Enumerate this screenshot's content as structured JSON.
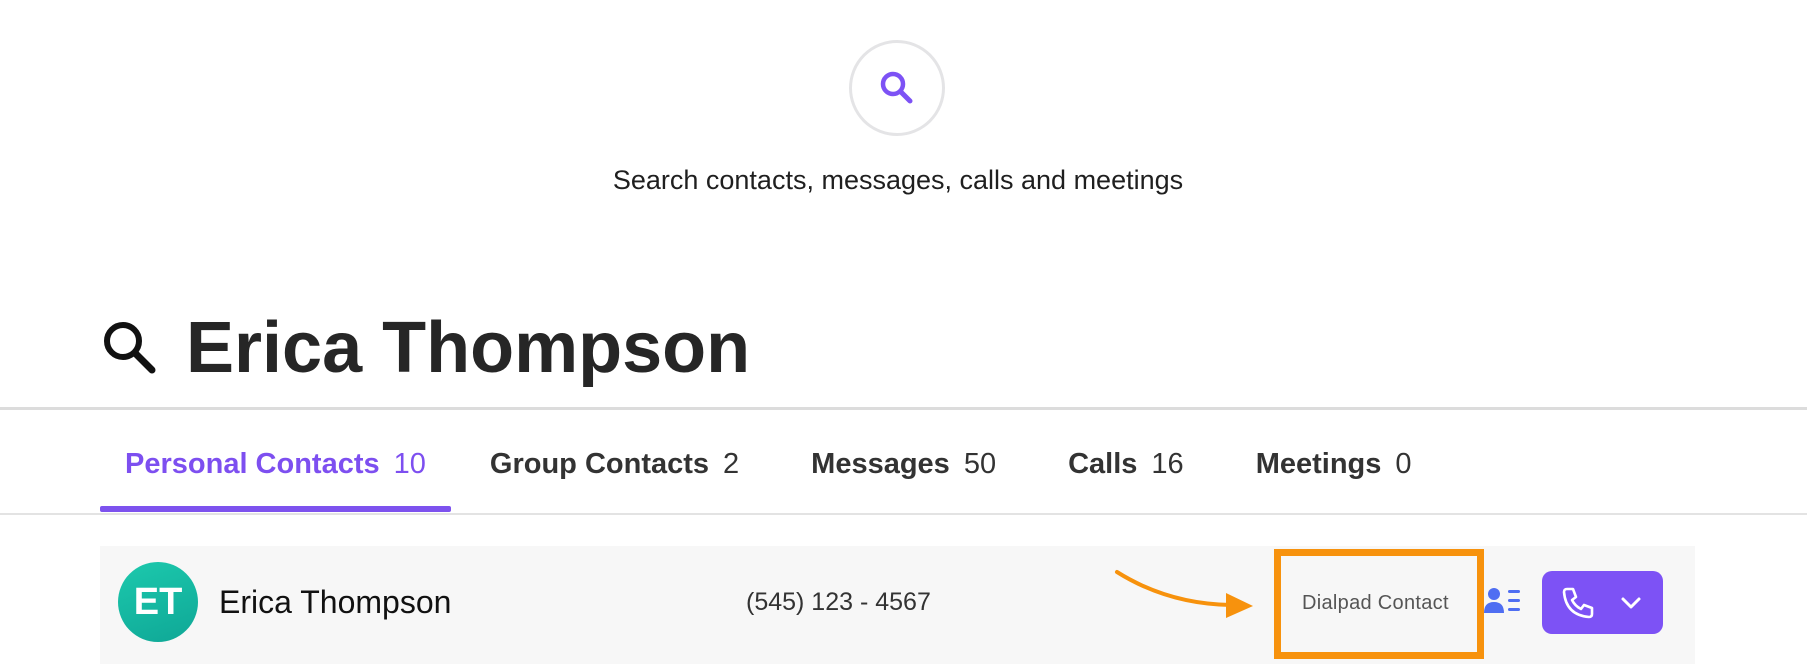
{
  "hero": {
    "icon": "search-icon",
    "text": "Search contacts, messages, calls and meetings"
  },
  "search": {
    "icon": "search-icon",
    "value": "Erica Thompson"
  },
  "tabs": [
    {
      "label": "Personal Contacts",
      "count": "10",
      "active": true
    },
    {
      "label": "Group Contacts",
      "count": "2"
    },
    {
      "label": "Messages",
      "count": "50"
    },
    {
      "label": "Calls",
      "count": "16"
    },
    {
      "label": "Meetings",
      "count": "0"
    }
  ],
  "results": [
    {
      "initials": "ET",
      "name": "Erica Thompson",
      "phone": "(545) 123 - 4567",
      "source": "Dialpad Contact",
      "contact_card_icon": "contact-card-icon",
      "call_icon": "phone-icon",
      "menu_icon": "chevron-down-icon"
    }
  ],
  "colors": {
    "accent": "#7d52f5",
    "avatar": "#14b8a2",
    "annotation": "#f7920d"
  }
}
